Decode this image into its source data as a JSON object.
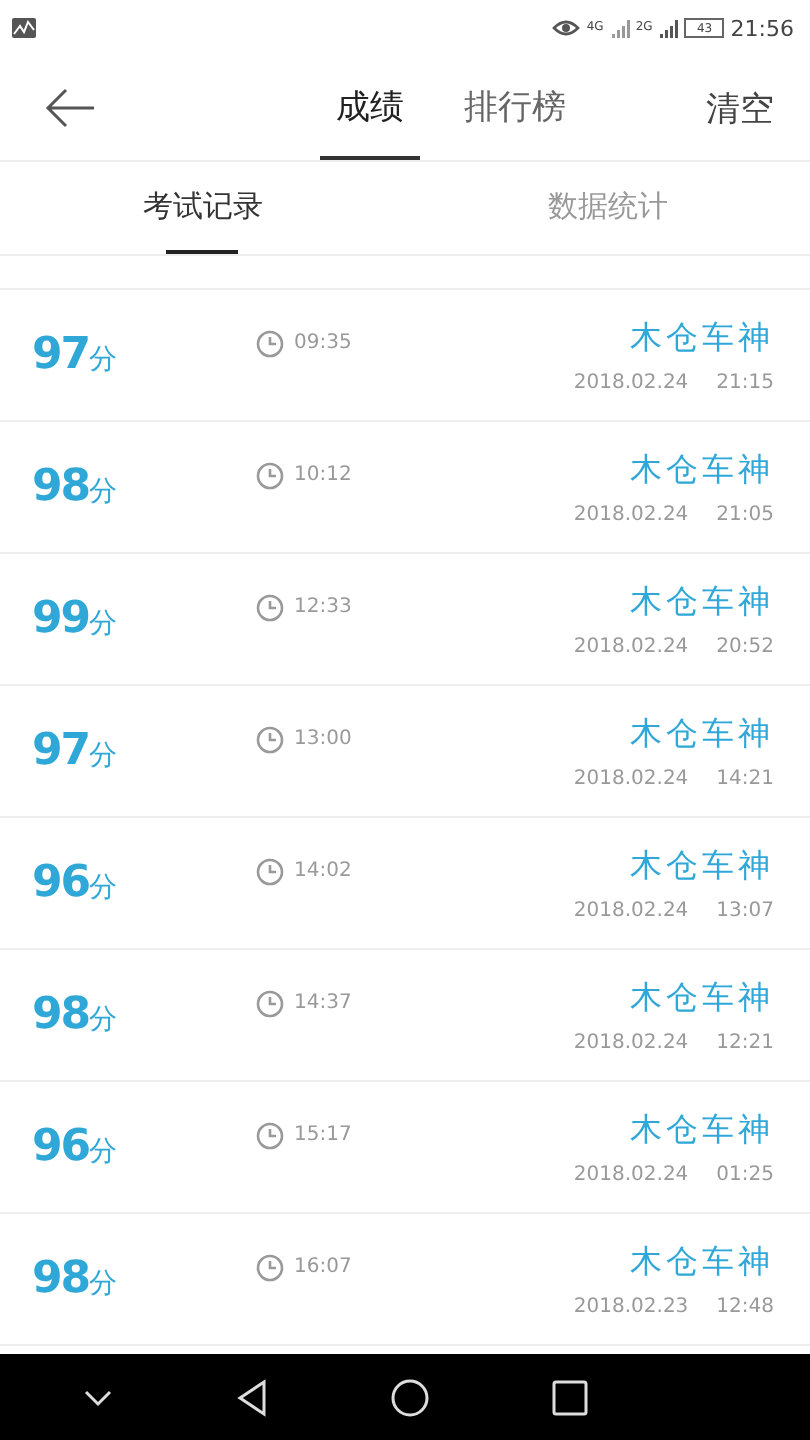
{
  "status_bar": {
    "network_4g": "4G",
    "network_2g": "2G",
    "battery": "43",
    "time": "21:56"
  },
  "header": {
    "tabs": [
      {
        "label": "成绩",
        "selected": true
      },
      {
        "label": "排行榜",
        "selected": false
      }
    ],
    "action": "清空"
  },
  "subtabs": [
    {
      "label": "考试记录",
      "selected": true
    },
    {
      "label": "数据统计",
      "selected": false
    }
  ],
  "records": [
    {
      "score": "97",
      "unit": "分",
      "duration": "09:35",
      "name": "木仓车神",
      "date": "2018.02.24",
      "time": "21:15"
    },
    {
      "score": "98",
      "unit": "分",
      "duration": "10:12",
      "name": "木仓车神",
      "date": "2018.02.24",
      "time": "21:05"
    },
    {
      "score": "99",
      "unit": "分",
      "duration": "12:33",
      "name": "木仓车神",
      "date": "2018.02.24",
      "time": "20:52"
    },
    {
      "score": "97",
      "unit": "分",
      "duration": "13:00",
      "name": "木仓车神",
      "date": "2018.02.24",
      "time": "14:21"
    },
    {
      "score": "96",
      "unit": "分",
      "duration": "14:02",
      "name": "木仓车神",
      "date": "2018.02.24",
      "time": "13:07"
    },
    {
      "score": "98",
      "unit": "分",
      "duration": "14:37",
      "name": "木仓车神",
      "date": "2018.02.24",
      "time": "12:21"
    },
    {
      "score": "96",
      "unit": "分",
      "duration": "15:17",
      "name": "木仓车神",
      "date": "2018.02.24",
      "time": "01:25"
    },
    {
      "score": "98",
      "unit": "分",
      "duration": "16:07",
      "name": "木仓车神",
      "date": "2018.02.23",
      "time": "12:48"
    }
  ]
}
